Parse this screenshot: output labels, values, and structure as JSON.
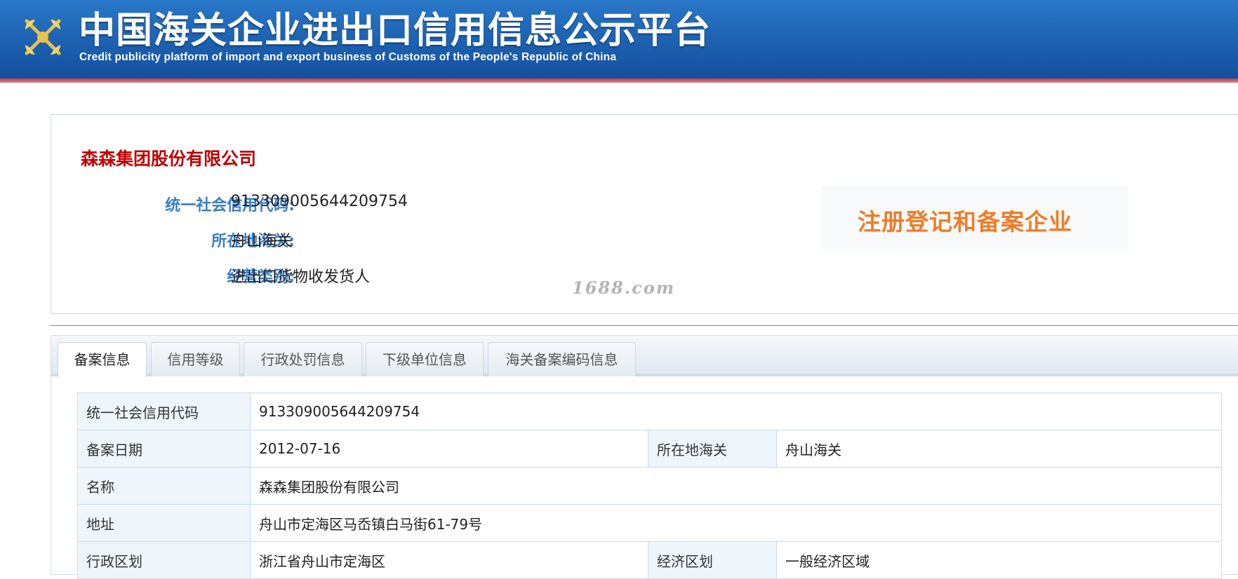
{
  "header": {
    "title": "中国海关企业进出口信用信息公示平台",
    "subtitle": "Credit publicity platform of import and export business of Customs of the People's Republic of China",
    "emblem_icon": "customs-emblem-icon"
  },
  "company": {
    "name": "森森集团股份有限公司",
    "rows": [
      {
        "label": "统一社会信用代码:",
        "value": "913309005644209754"
      },
      {
        "label": "所在地海关:",
        "value": "舟山海关"
      },
      {
        "label": "经营类别:",
        "value": "进出口货物收发货人"
      }
    ],
    "badge": "注册登记和备案企业"
  },
  "watermark": "1688.com",
  "tabs": [
    {
      "label": "备案信息",
      "active": true
    },
    {
      "label": "信用等级",
      "active": false
    },
    {
      "label": "行政处罚信息",
      "active": false
    },
    {
      "label": "下级单位信息",
      "active": false
    },
    {
      "label": "海关备案编码信息",
      "active": false
    }
  ],
  "table": {
    "credit_code_label": "统一社会信用代码",
    "credit_code_value": "913309005644209754",
    "record_date_label": "备案日期",
    "record_date_value": "2012-07-16",
    "customs_label": "所在地海关",
    "customs_value": "舟山海关",
    "name_label": "名称",
    "name_value": "森森集团股份有限公司",
    "address_label": "地址",
    "address_value": "舟山市定海区马岙镇白马街61-79号",
    "admin_region_label": "行政区划",
    "admin_region_value": "浙江省舟山市定海区",
    "econ_region_label": "经济区划",
    "econ_region_value": "一般经济区域"
  },
  "colors": {
    "header_blue": "#1f63b3",
    "company_red": "#c00000",
    "label_blue": "#3a7ec4",
    "badge_orange": "#f07c28"
  }
}
